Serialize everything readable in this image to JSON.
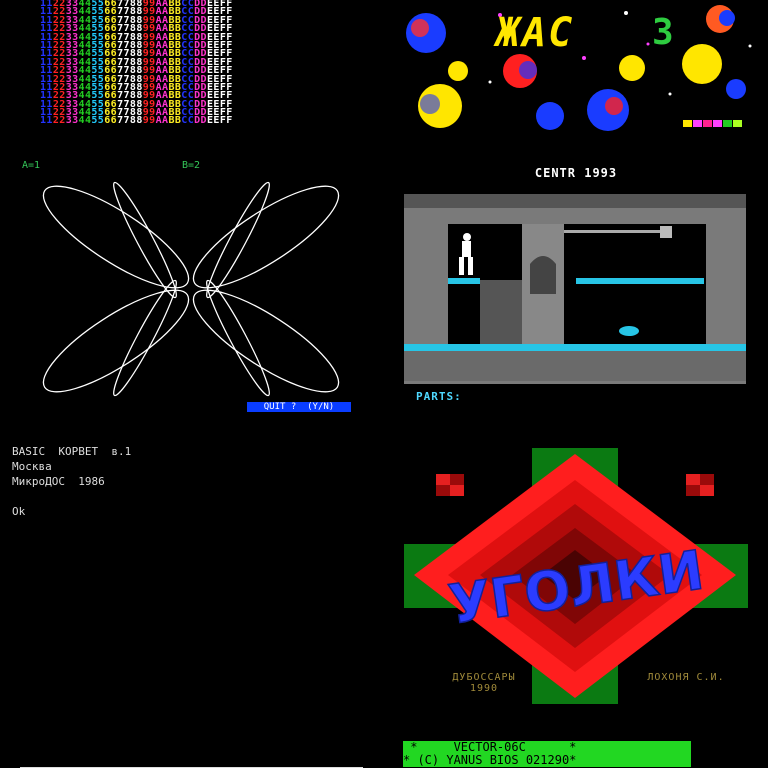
{
  "palette": {
    "row_text": "1122334455667788 99AABBCCDDEEFF",
    "pairs": [
      "11",
      "22",
      "33",
      "44",
      "55",
      "66",
      "77",
      "88",
      "99",
      "AA",
      "BB",
      "CC",
      "DD",
      "EE",
      "FF"
    ],
    "colors": [
      "#2233ff",
      "#ff2222",
      "#ff33cc",
      "#22cc22",
      "#22ccff",
      "#ffee22",
      "#ffffff",
      "#ffffff",
      "#ff2222",
      "#ff33cc",
      "#ffee22",
      "#2233ff",
      "#ff33cc",
      "#ffffff",
      "#ffffff"
    ],
    "row_count": 15
  },
  "space": {
    "title": "ЖАС",
    "number": "3"
  },
  "rose": {
    "label_a": "A=1",
    "label_b": "B=2",
    "quit_prompt": "QUIT ?  (Y/N)"
  },
  "game": {
    "title": "CENTR 1993",
    "parts_label": "PARTS:"
  },
  "basic": {
    "lines": [
      "BASIC  КОРВЕТ  в.1",
      "Москва",
      "МикроДОС  1986",
      "",
      "Ok"
    ]
  },
  "ugolki": {
    "title": "УГОЛКИ",
    "city": "ДУБОССАРЫ",
    "year": "1990",
    "author": "ЛОХОНЯ С.И."
  },
  "vector": {
    "line1": " *     VECTOR-06C      * ",
    "line2": "* (C) YANUS BIOS 021290*"
  }
}
